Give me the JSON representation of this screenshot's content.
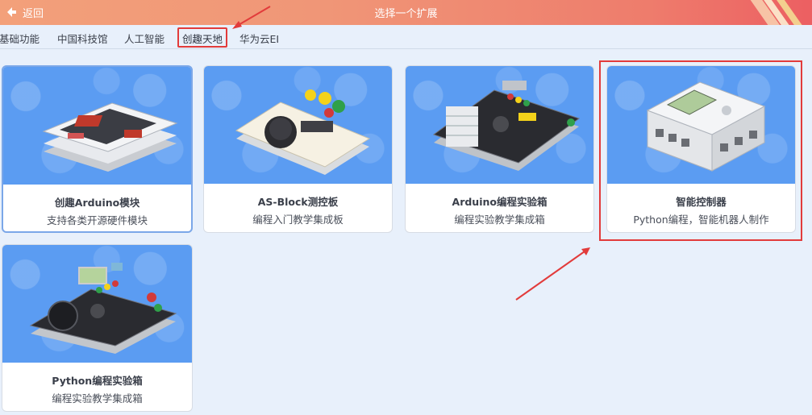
{
  "header": {
    "back_label": "返回",
    "title": "选择一个扩展",
    "gradient_colors": [
      "#f3a07a",
      "#ec5f62"
    ]
  },
  "tabs": [
    {
      "label": "基础功能",
      "active": false
    },
    {
      "label": "中国科技馆",
      "active": false
    },
    {
      "label": "人工智能",
      "active": false
    },
    {
      "label": "创趣天地",
      "active": true
    },
    {
      "label": "华为云EI",
      "active": false
    }
  ],
  "cards": [
    {
      "title": "创趣Arduino模块",
      "description": "支持各类开源硬件模块",
      "icon": "arduino-module-board-image"
    },
    {
      "title": "AS-Block测控板",
      "description": "编程入门教学集成板",
      "icon": "as-block-control-board-image"
    },
    {
      "title": "Arduino编程实验箱",
      "description": "编程实验教学集成箱",
      "icon": "arduino-lab-kit-image"
    },
    {
      "title": "智能控制器",
      "description": "Python编程，智能机器人制作",
      "icon": "smart-controller-image"
    },
    {
      "title": "Python编程实验箱",
      "description": "编程实验教学集成箱",
      "icon": "python-lab-kit-image"
    }
  ],
  "colors": {
    "page_background": "#e8f0fb",
    "card_image_background": "#5b9cf2",
    "annotation_red": "#e23b3b",
    "selected_border": "#7ba7e8"
  }
}
